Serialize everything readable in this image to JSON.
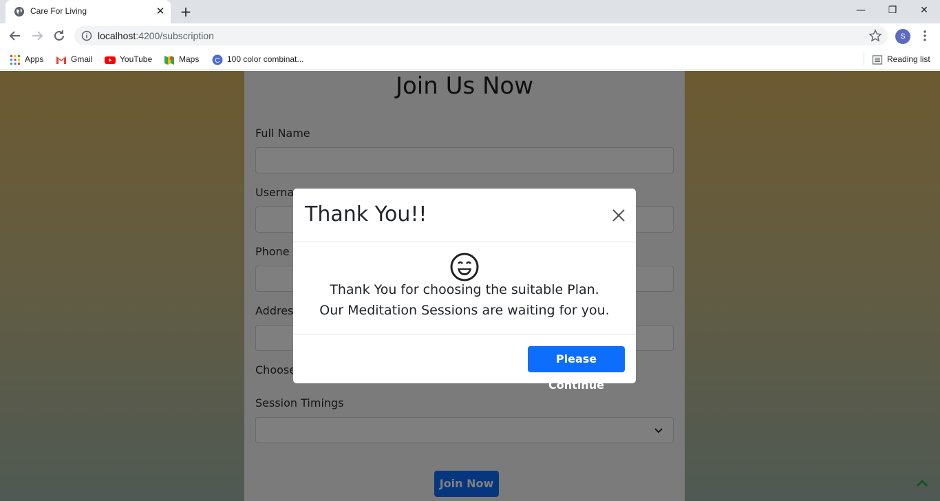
{
  "browser": {
    "tab_title": "Care For Living",
    "url_host": "localhost",
    "url_port_path": ":4200/subscription",
    "avatar_letter": "S",
    "bookmarks": [
      {
        "label": "Apps",
        "icon": "apps-grid-icon"
      },
      {
        "label": "Gmail",
        "icon": "gmail-icon"
      },
      {
        "label": "YouTube",
        "icon": "youtube-icon"
      },
      {
        "label": "Maps",
        "icon": "maps-icon"
      },
      {
        "label": "100 color combinat...",
        "icon": "color-site-icon"
      }
    ],
    "reading_list": "Reading list"
  },
  "form": {
    "title": "Join Us Now",
    "labels": {
      "full_name": "Full Name",
      "username": "Usernam",
      "phone": "Phone N",
      "address": "Addres",
      "choose": "Choose",
      "session_timings": "Session Timings"
    },
    "submit_label": "Join Now"
  },
  "modal": {
    "title": "Thank You!!",
    "line1": "Thank You for choosing the suitable Plan.",
    "line2": "Our Meditation Sessions are waiting for you.",
    "continue_label": "Please Continue"
  },
  "colors": {
    "primary": "#0d6efd",
    "backdrop": "rgba(0,0,0,0.5)"
  }
}
